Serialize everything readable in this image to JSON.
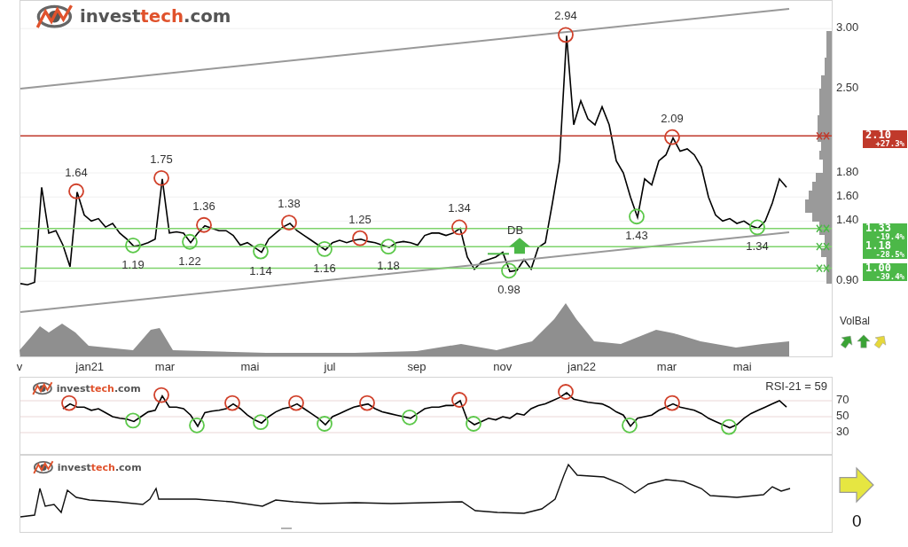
{
  "price_chart": {
    "logo": {
      "brand": "invest",
      "accent": "tech",
      "suffix": ".com"
    },
    "chart_data": {
      "type": "line",
      "series": [
        {
          "color": "#000000",
          "values": [
            0.88,
            0.87,
            0.89,
            1.68,
            1.3,
            1.32,
            1.2,
            1.02,
            1.64,
            1.45,
            1.4,
            1.42,
            1.35,
            1.38,
            1.3,
            1.25,
            1.19,
            1.2,
            1.22,
            1.25,
            1.75,
            1.3,
            1.31,
            1.3,
            1.22,
            1.3,
            1.36,
            1.34,
            1.32,
            1.32,
            1.28,
            1.2,
            1.22,
            1.18,
            1.14,
            1.25,
            1.3,
            1.35,
            1.38,
            1.32,
            1.28,
            1.24,
            1.2,
            1.16,
            1.22,
            1.24,
            1.22,
            1.24,
            1.25,
            1.23,
            1.22,
            1.2,
            1.18,
            1.22,
            1.23,
            1.22,
            1.2,
            1.28,
            1.3,
            1.3,
            1.28,
            1.3,
            1.34,
            1.1,
            1.0,
            1.06,
            1.08,
            1.1,
            1.14,
            0.98,
            0.99,
            1.08,
            1.0,
            1.18,
            1.22,
            1.55,
            1.9,
            2.94,
            2.2,
            2.4,
            2.25,
            2.2,
            2.35,
            2.2,
            1.9,
            1.8,
            1.6,
            1.43,
            1.75,
            1.7,
            1.9,
            1.95,
            2.09,
            1.98,
            2.0,
            1.95,
            1.85,
            1.6,
            1.45,
            1.4,
            1.42,
            1.38,
            1.4,
            1.36,
            1.34,
            1.4,
            1.55,
            1.75,
            1.68
          ]
        }
      ],
      "yticks": [
        {
          "value": 3.0,
          "label": "3.00"
        },
        {
          "value": 2.5,
          "label": "2.50"
        },
        {
          "value": 1.8,
          "label": "1.80"
        },
        {
          "value": 1.6,
          "label": "1.60"
        },
        {
          "value": 1.4,
          "label": "1.40"
        },
        {
          "value": 0.9,
          "label": "0.90"
        }
      ],
      "ylim": [
        0.26,
        3.23
      ],
      "grid": true
    },
    "months": [
      "v",
      "jan21",
      "mar",
      "mai",
      "jul",
      "sep",
      "nov",
      "jan22",
      "mar",
      "mai"
    ],
    "turning_points": [
      {
        "kind": "top",
        "label": "1.64"
      },
      {
        "kind": "top",
        "label": "1.75"
      },
      {
        "kind": "top",
        "label": "1.36"
      },
      {
        "kind": "top",
        "label": "1.38"
      },
      {
        "kind": "top",
        "label": "1.25"
      },
      {
        "kind": "top",
        "label": "1.34"
      },
      {
        "kind": "top",
        "label": "2.94"
      },
      {
        "kind": "top",
        "label": "2.09"
      },
      {
        "kind": "bottom",
        "label": "1.19"
      },
      {
        "kind": "bottom",
        "label": "1.22"
      },
      {
        "kind": "bottom",
        "label": "1.14"
      },
      {
        "kind": "bottom",
        "label": "1.16"
      },
      {
        "kind": "bottom",
        "label": "1.18"
      },
      {
        "kind": "bottom",
        "label": "0.98"
      },
      {
        "kind": "bottom",
        "label": "1.43"
      },
      {
        "kind": "bottom",
        "label": "1.34"
      }
    ],
    "levels": [
      {
        "kind": "resistance",
        "value": "2.10",
        "change": "+27.3%"
      },
      {
        "kind": "support",
        "value": "1.33",
        "change": "-19.4%"
      },
      {
        "kind": "support",
        "value": "1.18",
        "change": "-28.5%"
      },
      {
        "kind": "support",
        "value": "1.00",
        "change": "-39.4%"
      }
    ],
    "pattern": {
      "label": "DB"
    },
    "volume_balance": {
      "label": "VolBal",
      "signals": [
        {
          "kind": "rising",
          "color": "#3aa335"
        },
        {
          "kind": "up",
          "color": "#3aa335"
        },
        {
          "kind": "rising",
          "color": "#e6d83a"
        }
      ]
    }
  },
  "rsi_chart": {
    "logo": {
      "brand": "invest",
      "accent": "tech",
      "suffix": ".com"
    },
    "reading": "RSI-21 = 59",
    "chart_data": {
      "type": "line",
      "series": [
        {
          "color": "#000000",
          "values": [
            null,
            null,
            null,
            null,
            null,
            null,
            60,
            66,
            62,
            62,
            58,
            60,
            55,
            50,
            48,
            47,
            44,
            50,
            56,
            58,
            76,
            62,
            62,
            60,
            52,
            38,
            55,
            57,
            58,
            60,
            66,
            60,
            52,
            46,
            42,
            50,
            56,
            60,
            62,
            66,
            60,
            54,
            48,
            40,
            50,
            54,
            58,
            62,
            64,
            66,
            60,
            56,
            54,
            52,
            50,
            48,
            54,
            60,
            62,
            62,
            64,
            64,
            70,
            46,
            40,
            44,
            48,
            46,
            50,
            48,
            54,
            52,
            60,
            64,
            66,
            70,
            74,
            80,
            72,
            70,
            68,
            67,
            66,
            62,
            56,
            52,
            38,
            48,
            50,
            52,
            58,
            62,
            66,
            62,
            60,
            58,
            54,
            48,
            44,
            40,
            36,
            40,
            48,
            54,
            58,
            62,
            66,
            70,
            62
          ]
        }
      ],
      "yticks": [
        70,
        50,
        30
      ],
      "ylim": [
        1.1,
        98.9
      ],
      "grid": true
    },
    "turning_points": [
      {
        "kind": "top"
      },
      {
        "kind": "top"
      },
      {
        "kind": "top"
      },
      {
        "kind": "top"
      },
      {
        "kind": "top"
      },
      {
        "kind": "top"
      },
      {
        "kind": "top"
      },
      {
        "kind": "top"
      },
      {
        "kind": "bottom"
      },
      {
        "kind": "bottom"
      },
      {
        "kind": "bottom"
      },
      {
        "kind": "bottom"
      },
      {
        "kind": "bottom"
      },
      {
        "kind": "bottom"
      },
      {
        "kind": "bottom"
      },
      {
        "kind": "bottom"
      }
    ]
  },
  "strength_panel": {
    "logo": {
      "brand": "invest",
      "accent": "tech",
      "suffix": ".com"
    },
    "signal": {
      "kind": "right",
      "color": "#e6e641"
    },
    "value": "0"
  }
}
